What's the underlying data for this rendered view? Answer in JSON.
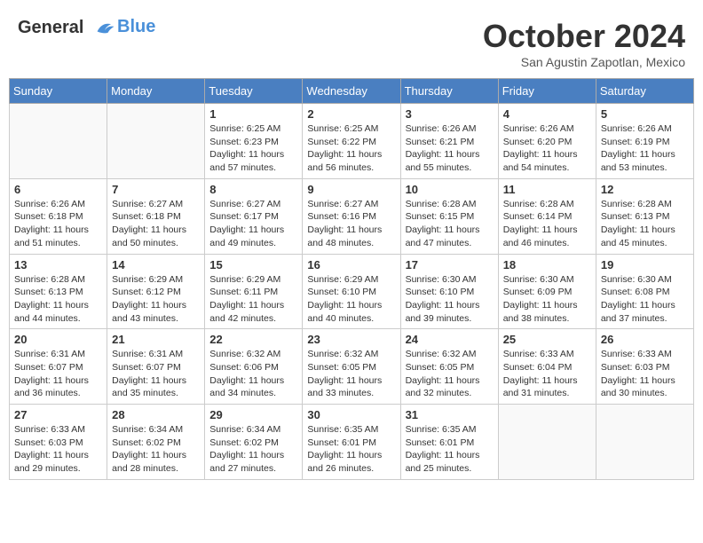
{
  "header": {
    "logo_line1": "General",
    "logo_line2": "Blue",
    "month": "October 2024",
    "location": "San Agustin Zapotlan, Mexico"
  },
  "days_of_week": [
    "Sunday",
    "Monday",
    "Tuesday",
    "Wednesday",
    "Thursday",
    "Friday",
    "Saturday"
  ],
  "weeks": [
    [
      {
        "day": "",
        "empty": true
      },
      {
        "day": "",
        "empty": true
      },
      {
        "day": "1",
        "sunrise": "6:25 AM",
        "sunset": "6:23 PM",
        "daylight": "11 hours and 57 minutes."
      },
      {
        "day": "2",
        "sunrise": "6:25 AM",
        "sunset": "6:22 PM",
        "daylight": "11 hours and 56 minutes."
      },
      {
        "day": "3",
        "sunrise": "6:26 AM",
        "sunset": "6:21 PM",
        "daylight": "11 hours and 55 minutes."
      },
      {
        "day": "4",
        "sunrise": "6:26 AM",
        "sunset": "6:20 PM",
        "daylight": "11 hours and 54 minutes."
      },
      {
        "day": "5",
        "sunrise": "6:26 AM",
        "sunset": "6:19 PM",
        "daylight": "11 hours and 53 minutes."
      }
    ],
    [
      {
        "day": "6",
        "sunrise": "6:26 AM",
        "sunset": "6:18 PM",
        "daylight": "11 hours and 51 minutes."
      },
      {
        "day": "7",
        "sunrise": "6:27 AM",
        "sunset": "6:18 PM",
        "daylight": "11 hours and 50 minutes."
      },
      {
        "day": "8",
        "sunrise": "6:27 AM",
        "sunset": "6:17 PM",
        "daylight": "11 hours and 49 minutes."
      },
      {
        "day": "9",
        "sunrise": "6:27 AM",
        "sunset": "6:16 PM",
        "daylight": "11 hours and 48 minutes."
      },
      {
        "day": "10",
        "sunrise": "6:28 AM",
        "sunset": "6:15 PM",
        "daylight": "11 hours and 47 minutes."
      },
      {
        "day": "11",
        "sunrise": "6:28 AM",
        "sunset": "6:14 PM",
        "daylight": "11 hours and 46 minutes."
      },
      {
        "day": "12",
        "sunrise": "6:28 AM",
        "sunset": "6:13 PM",
        "daylight": "11 hours and 45 minutes."
      }
    ],
    [
      {
        "day": "13",
        "sunrise": "6:28 AM",
        "sunset": "6:13 PM",
        "daylight": "11 hours and 44 minutes."
      },
      {
        "day": "14",
        "sunrise": "6:29 AM",
        "sunset": "6:12 PM",
        "daylight": "11 hours and 43 minutes."
      },
      {
        "day": "15",
        "sunrise": "6:29 AM",
        "sunset": "6:11 PM",
        "daylight": "11 hours and 42 minutes."
      },
      {
        "day": "16",
        "sunrise": "6:29 AM",
        "sunset": "6:10 PM",
        "daylight": "11 hours and 40 minutes."
      },
      {
        "day": "17",
        "sunrise": "6:30 AM",
        "sunset": "6:10 PM",
        "daylight": "11 hours and 39 minutes."
      },
      {
        "day": "18",
        "sunrise": "6:30 AM",
        "sunset": "6:09 PM",
        "daylight": "11 hours and 38 minutes."
      },
      {
        "day": "19",
        "sunrise": "6:30 AM",
        "sunset": "6:08 PM",
        "daylight": "11 hours and 37 minutes."
      }
    ],
    [
      {
        "day": "20",
        "sunrise": "6:31 AM",
        "sunset": "6:07 PM",
        "daylight": "11 hours and 36 minutes."
      },
      {
        "day": "21",
        "sunrise": "6:31 AM",
        "sunset": "6:07 PM",
        "daylight": "11 hours and 35 minutes."
      },
      {
        "day": "22",
        "sunrise": "6:32 AM",
        "sunset": "6:06 PM",
        "daylight": "11 hours and 34 minutes."
      },
      {
        "day": "23",
        "sunrise": "6:32 AM",
        "sunset": "6:05 PM",
        "daylight": "11 hours and 33 minutes."
      },
      {
        "day": "24",
        "sunrise": "6:32 AM",
        "sunset": "6:05 PM",
        "daylight": "11 hours and 32 minutes."
      },
      {
        "day": "25",
        "sunrise": "6:33 AM",
        "sunset": "6:04 PM",
        "daylight": "11 hours and 31 minutes."
      },
      {
        "day": "26",
        "sunrise": "6:33 AM",
        "sunset": "6:03 PM",
        "daylight": "11 hours and 30 minutes."
      }
    ],
    [
      {
        "day": "27",
        "sunrise": "6:33 AM",
        "sunset": "6:03 PM",
        "daylight": "11 hours and 29 minutes."
      },
      {
        "day": "28",
        "sunrise": "6:34 AM",
        "sunset": "6:02 PM",
        "daylight": "11 hours and 28 minutes."
      },
      {
        "day": "29",
        "sunrise": "6:34 AM",
        "sunset": "6:02 PM",
        "daylight": "11 hours and 27 minutes."
      },
      {
        "day": "30",
        "sunrise": "6:35 AM",
        "sunset": "6:01 PM",
        "daylight": "11 hours and 26 minutes."
      },
      {
        "day": "31",
        "sunrise": "6:35 AM",
        "sunset": "6:01 PM",
        "daylight": "11 hours and 25 minutes."
      },
      {
        "day": "",
        "empty": true
      },
      {
        "day": "",
        "empty": true
      }
    ]
  ],
  "labels": {
    "sunrise": "Sunrise:",
    "sunset": "Sunset:",
    "daylight": "Daylight:"
  }
}
